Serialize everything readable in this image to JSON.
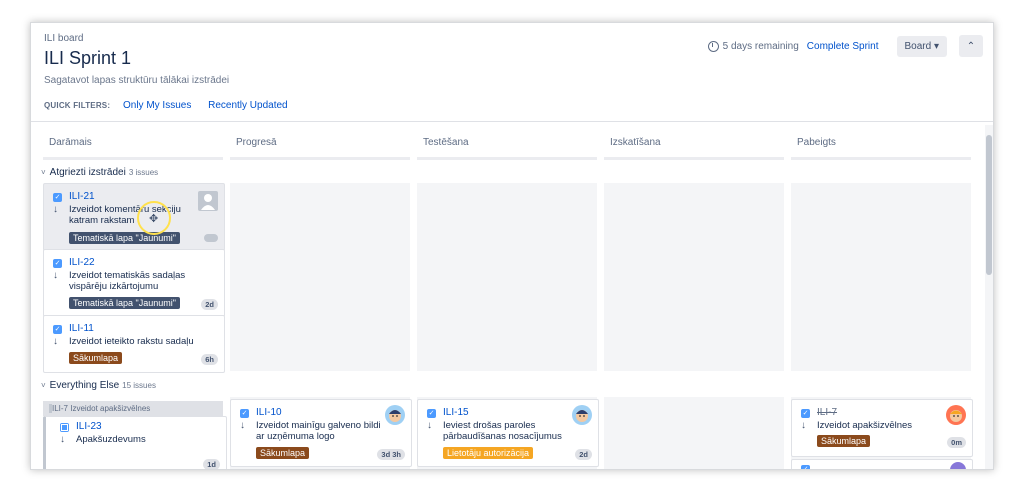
{
  "header": {
    "breadcrumb": "ILI board",
    "title": "ILI Sprint 1",
    "subtitle": "Sagatavot lapas struktūru tālākai izstrādei",
    "quick_filters_label": "QUICK FILTERS:",
    "quick_filters": [
      "Only My Issues",
      "Recently Updated"
    ],
    "remaining": "5 days remaining",
    "complete_sprint": "Complete Sprint",
    "board_label": "Board",
    "board_caret": "▾",
    "collapse_glyph": "⌃"
  },
  "columns": [
    "Darāmais",
    "Progresā",
    "Testēšana",
    "Izskatīšana",
    "Pabeigts"
  ],
  "swimlanes": [
    {
      "title": "Atgriezti izstrādei",
      "count": "3 issues"
    },
    {
      "title": "Everything Else",
      "count": "15 issues"
    }
  ],
  "cards": {
    "ili21": {
      "key": "ILI-21",
      "summary1": "Izveidot komentāru sekciju",
      "summary2": "katram rakstam",
      "epic": "Tematiskā lapa \"Jaunumi\""
    },
    "ili22": {
      "key": "ILI-22",
      "summary1": "Izveidot tematiskās sadaļas",
      "summary2": "vispārēju izkārtojumu",
      "epic": "Tematiskā lapa \"Jaunumi\"",
      "estimate": "2d"
    },
    "ili11": {
      "key": "ILI-11",
      "summary1": "Izveidot ieteikto rakstu sadaļu",
      "epic": "Sākumlapa",
      "estimate": "6h"
    },
    "ili23": {
      "parent": "ILI-7 Izveidot apakšizvēlnes",
      "key": "ILI-23",
      "summary1": "Apakšuzdevums",
      "estimate": "1d"
    },
    "ili10": {
      "key": "ILI-10",
      "summary1": "Izveidot mainīgu galveno bildi",
      "summary2": "ar uzņēmuma logo",
      "epic": "Sākumlapa",
      "estimate": "3d 3h"
    },
    "ili15": {
      "key": "ILI-15",
      "summary1": "Ieviest drošas paroles",
      "summary2": "pārbaudīšanas nosacījumus",
      "epic": "Lietotāju autorizācija",
      "estimate": "2d"
    },
    "ili7": {
      "key": "ILI-7",
      "summary1": "Izveidot apakšizvēlnes",
      "epic": "Sākumlapa",
      "estimate": "0m"
    }
  },
  "icons": {
    "check": "✓",
    "down_arrow": "↓",
    "move_cursor": "✥",
    "chevron": "˅"
  },
  "colors": {
    "epic_dark": "#42526e",
    "epic_brown": "#8b4a1c",
    "epic_orange": "#f5a623",
    "link": "#0052cc"
  }
}
